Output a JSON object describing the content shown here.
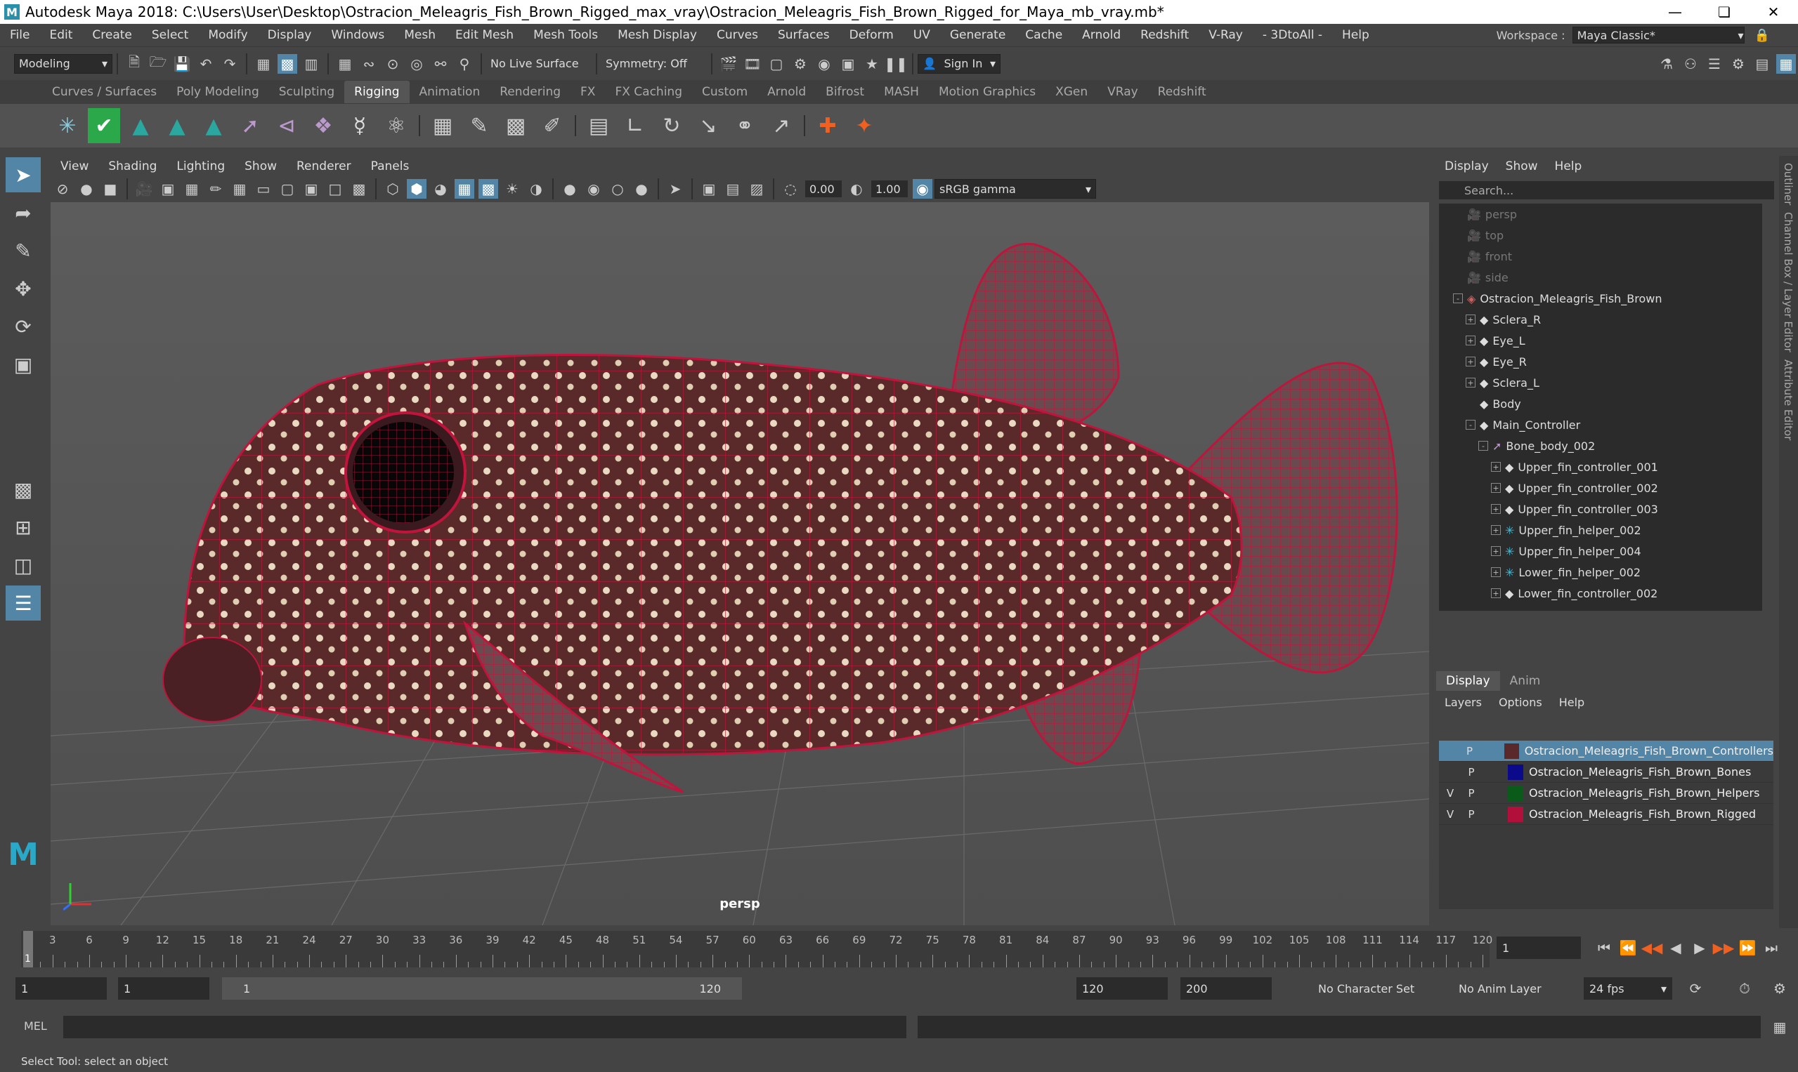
{
  "title": "Autodesk Maya 2018: C:\\Users\\User\\Desktop\\Ostracion_Meleagris_Fish_Brown_Rigged_max_vray\\Ostracion_Meleagris_Fish_Brown_Rigged_for_Maya_mb_vray.mb*",
  "menu": [
    "File",
    "Edit",
    "Create",
    "Select",
    "Modify",
    "Display",
    "Windows",
    "Mesh",
    "Edit Mesh",
    "Mesh Tools",
    "Mesh Display",
    "Curves",
    "Surfaces",
    "Deform",
    "UV",
    "Generate",
    "Cache",
    "Arnold",
    "Redshift",
    "V-Ray",
    "- 3DtoAll -",
    "Help"
  ],
  "workspace": {
    "label": "Workspace :",
    "value": "Maya Classic*"
  },
  "status": {
    "mode": "Modeling",
    "live_surface": "No Live Surface",
    "symmetry": "Symmetry: Off",
    "sign_in": "Sign In"
  },
  "shelf_tabs": [
    "Curves / Surfaces",
    "Poly Modeling",
    "Sculpting",
    "Rigging",
    "Animation",
    "Rendering",
    "FX",
    "FX Caching",
    "Custom",
    "Arnold",
    "Bifrost",
    "MASH",
    "Motion Graphics",
    "XGen",
    "VRay",
    "Redshift"
  ],
  "active_shelf_tab": "Rigging",
  "viewport": {
    "menu": [
      "View",
      "Shading",
      "Lighting",
      "Show",
      "Renderer",
      "Panels"
    ],
    "exposure": "0.00",
    "gamma": "1.00",
    "color_space": "sRGB gamma",
    "camera": "persp"
  },
  "outliner": {
    "menu": [
      "Display",
      "Show",
      "Help"
    ],
    "search_placeholder": "Search...",
    "items": [
      {
        "label": "persp",
        "level": 0,
        "dim": true,
        "icon": "camera"
      },
      {
        "label": "top",
        "level": 0,
        "dim": true,
        "icon": "camera"
      },
      {
        "label": "front",
        "level": 0,
        "dim": true,
        "icon": "camera"
      },
      {
        "label": "side",
        "level": 0,
        "dim": true,
        "icon": "camera"
      },
      {
        "label": "Ostracion_Meleagris_Fish_Brown",
        "level": 0,
        "dim": false,
        "icon": "group",
        "exp": "-"
      },
      {
        "label": "Sclera_R",
        "level": 1,
        "dim": false,
        "icon": "mesh",
        "exp": "+"
      },
      {
        "label": "Eye_L",
        "level": 1,
        "dim": false,
        "icon": "mesh",
        "exp": "+"
      },
      {
        "label": "Eye_R",
        "level": 1,
        "dim": false,
        "icon": "mesh",
        "exp": "+"
      },
      {
        "label": "Sclera_L",
        "level": 1,
        "dim": false,
        "icon": "mesh",
        "exp": "+"
      },
      {
        "label": "Body",
        "level": 1,
        "dim": false,
        "icon": "mesh",
        "exp": ""
      },
      {
        "label": "Main_Controller",
        "level": 1,
        "dim": false,
        "icon": "mesh",
        "exp": "-"
      },
      {
        "label": "Bone_body_002",
        "level": 2,
        "dim": false,
        "icon": "joint",
        "exp": "-"
      },
      {
        "label": "Upper_fin_controller_001",
        "level": 3,
        "dim": false,
        "icon": "mesh",
        "exp": "+"
      },
      {
        "label": "Upper_fin_controller_002",
        "level": 3,
        "dim": false,
        "icon": "mesh",
        "exp": "+"
      },
      {
        "label": "Upper_fin_controller_003",
        "level": 3,
        "dim": false,
        "icon": "mesh",
        "exp": "+"
      },
      {
        "label": "Upper_fin_helper_002",
        "level": 3,
        "dim": false,
        "icon": "helper",
        "exp": "+"
      },
      {
        "label": "Upper_fin_helper_004",
        "level": 3,
        "dim": false,
        "icon": "helper",
        "exp": "+"
      },
      {
        "label": "Lower_fin_helper_002",
        "level": 3,
        "dim": false,
        "icon": "helper",
        "exp": "+"
      },
      {
        "label": "Lower_fin_controller_002",
        "level": 3,
        "dim": false,
        "icon": "mesh",
        "exp": "+"
      }
    ]
  },
  "channel_box": {
    "tabs": [
      "Display",
      "Anim"
    ],
    "sub": [
      "Layers",
      "Options",
      "Help"
    ],
    "layers": [
      {
        "name": "Ostracion_Meleagris_Fish_Brown_Controllers",
        "v": "",
        "p": "P",
        "color": "#5a2a2a",
        "selected": true
      },
      {
        "name": "Ostracion_Meleagris_Fish_Brown_Bones",
        "v": "",
        "p": "P",
        "color": "#0a0a8a",
        "selected": false
      },
      {
        "name": "Ostracion_Meleagris_Fish_Brown_Helpers",
        "v": "V",
        "p": "P",
        "color": "#0a5a1a",
        "selected": false
      },
      {
        "name": "Ostracion_Meleagris_Fish_Brown_Rigged",
        "v": "V",
        "p": "P",
        "color": "#b0103a",
        "selected": false
      }
    ]
  },
  "side_tabs": [
    "Outliner",
    "Channel Box / Layer Editor",
    "Attribute Editor"
  ],
  "timeline": {
    "ticks": [
      "3",
      "6",
      "9",
      "12",
      "15",
      "18",
      "21",
      "24",
      "27",
      "30",
      "33",
      "36",
      "39",
      "42",
      "45",
      "48",
      "51",
      "54",
      "57",
      "60",
      "63",
      "66",
      "69",
      "72",
      "75",
      "78",
      "81",
      "84",
      "87",
      "90",
      "93",
      "96",
      "99",
      "102",
      "105",
      "108",
      "111",
      "114",
      "117",
      "120"
    ],
    "current": "1",
    "current_field": "1"
  },
  "range": {
    "start": "1",
    "anim_start": "1",
    "range_start": "1",
    "range_end": "120",
    "end": "120",
    "anim_end": "200",
    "character_set": "No Character Set",
    "anim_layer": "No Anim Layer",
    "fps": "24 fps"
  },
  "cmd": {
    "label": "MEL"
  },
  "help_line": "Select Tool: select an object",
  "colors": {
    "accent": "#5285a6",
    "wire": "#c0143c",
    "fish": "#5a2a2a"
  }
}
